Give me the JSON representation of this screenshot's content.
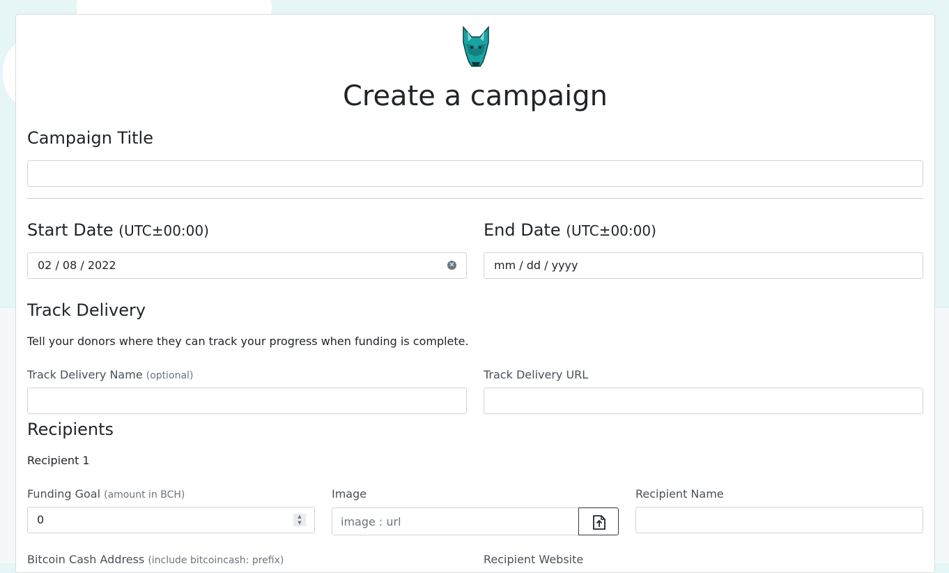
{
  "page": {
    "title": "Create a campaign"
  },
  "campaign_title": {
    "label": "Campaign Title",
    "value": ""
  },
  "start_date": {
    "label": "Start Date",
    "tz": "(UTC±00:00)",
    "value": "02 / 08 / 2022"
  },
  "end_date": {
    "label": "End Date",
    "tz": "(UTC±00:00)",
    "placeholder": "mm / dd / yyyy"
  },
  "track_delivery": {
    "heading": "Track Delivery",
    "description": "Tell your donors where they can track your progress when funding is complete.",
    "name_label": "Track Delivery Name",
    "name_hint": "(optional)",
    "url_label": "Track Delivery URL"
  },
  "recipients": {
    "heading": "Recipients",
    "items": [
      {
        "title": "Recipient 1",
        "funding_goal_label": "Funding Goal",
        "funding_goal_hint": "(amount in BCH)",
        "funding_goal_value": "0",
        "image_label": "Image",
        "image_placeholder": "image : url",
        "name_label": "Recipient Name",
        "address_label": "Bitcoin Cash Address",
        "address_hint": "(include bitcoincash: prefix)",
        "website_label": "Recipient Website"
      }
    ]
  },
  "icons": {
    "logo": "wolf-logo-icon",
    "clear": "clear-date-icon",
    "upload": "file-upload-icon"
  },
  "colors": {
    "brand_teal": "#1fa6a6",
    "background": "#e6f5f5"
  }
}
